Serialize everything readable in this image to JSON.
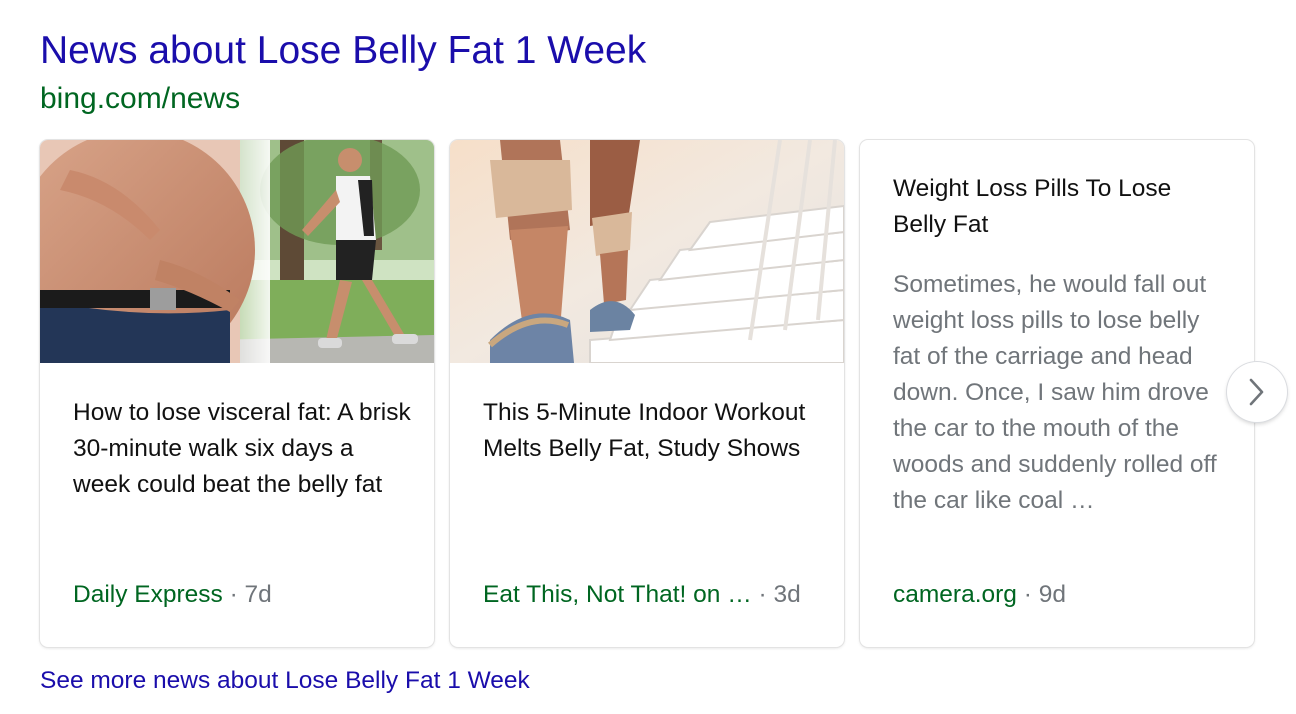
{
  "header": {
    "title": "News about Lose Belly Fat 1 Week",
    "source": "bing.com/news"
  },
  "cards": [
    {
      "headline": "How to lose visceral fat: A brisk 30-minute walk six days a week could beat the belly fat",
      "publisher": "Daily Express",
      "separator": " · ",
      "age": "7d",
      "image": "belly-fat-and-walking-man-image"
    },
    {
      "headline": "This 5-Minute Indoor Workout Melts Belly Fat, Study Shows",
      "publisher": "Eat This, Not That! on …",
      "separator": " · ",
      "age": "3d",
      "image": "feet-climbing-stairs-image"
    },
    {
      "headline": "Weight Loss Pills To Lose Belly Fat",
      "snippet": "Sometimes, he would fall out weight loss pills to lose belly fat of the carriage and head down. Once, I saw him drove the car to the mouth of the woods and suddenly rolled off the car like coal …",
      "publisher": "camera.org",
      "separator": " · ",
      "age": "9d"
    }
  ],
  "carousel": {
    "next_icon": "chevron-right-icon"
  },
  "footer": {
    "see_more": "See more news about Lose Belly Fat 1 Week"
  },
  "colors": {
    "link": "#1a0dab",
    "source_green": "#006621",
    "text": "#111111",
    "muted": "#70757a"
  }
}
